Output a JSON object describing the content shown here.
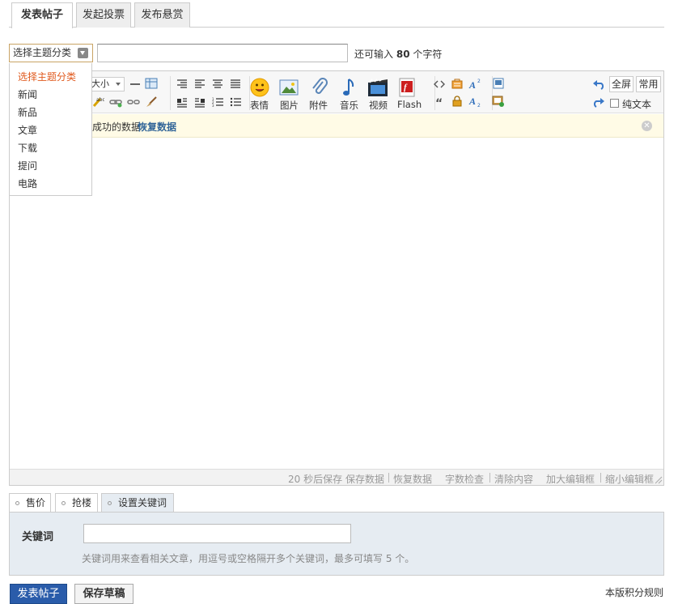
{
  "tabs": [
    {
      "label": "发表帖子",
      "active": true
    },
    {
      "label": "发起投票",
      "active": false
    },
    {
      "label": "发布悬赏",
      "active": false
    }
  ],
  "subject": {
    "type_selected": "选择主题分类",
    "type_options": [
      "选择主题分类",
      "新闻",
      "新品",
      "文章",
      "下载",
      "提问",
      "电路"
    ],
    "input_value": "",
    "hint_prefix": "还可输入",
    "hint_count": "80",
    "hint_suffix": "个字符"
  },
  "toolbar": {
    "font_size_label": "大小",
    "big_buttons": [
      {
        "label": "表情",
        "icon": "smile-icon"
      },
      {
        "label": "图片",
        "icon": "image-icon"
      },
      {
        "label": "附件",
        "icon": "paperclip-icon"
      },
      {
        "label": "音乐",
        "icon": "music-note-icon"
      },
      {
        "label": "视频",
        "icon": "film-icon"
      },
      {
        "label": "Flash",
        "icon": "flash-icon"
      }
    ],
    "fullscreen_label": "全屏",
    "common_label": "常用",
    "plain_text_label": "纯文本"
  },
  "notice": {
    "text": "成功的数据",
    "restore_link": "恢复数据"
  },
  "statusbar": {
    "autosave": "20 秒后保存",
    "save_data": "保存数据",
    "restore_data": "恢复数据",
    "char_check": "字数检查",
    "clear_content": "清除内容",
    "enlarge": "加大编辑框",
    "shrink": "缩小编辑框"
  },
  "subtabs": [
    {
      "label": "售价",
      "active": false
    },
    {
      "label": "抢楼",
      "active": false
    },
    {
      "label": "设置关键词",
      "active": true
    }
  ],
  "keywords": {
    "label": "关键词",
    "value": "",
    "hint": "关键词用来查看相关文章，用逗号或空格隔开多个关键词，最多可填写 5 个。"
  },
  "actions": {
    "post_label": "发表帖子",
    "draft_label": "保存草稿",
    "rules_link": "本版积分规则"
  },
  "colors": {
    "accent_blue": "#2a5caa",
    "selected_option": "#e05a1e",
    "link": "#336699",
    "panel_bg": "#e6ecf2"
  }
}
